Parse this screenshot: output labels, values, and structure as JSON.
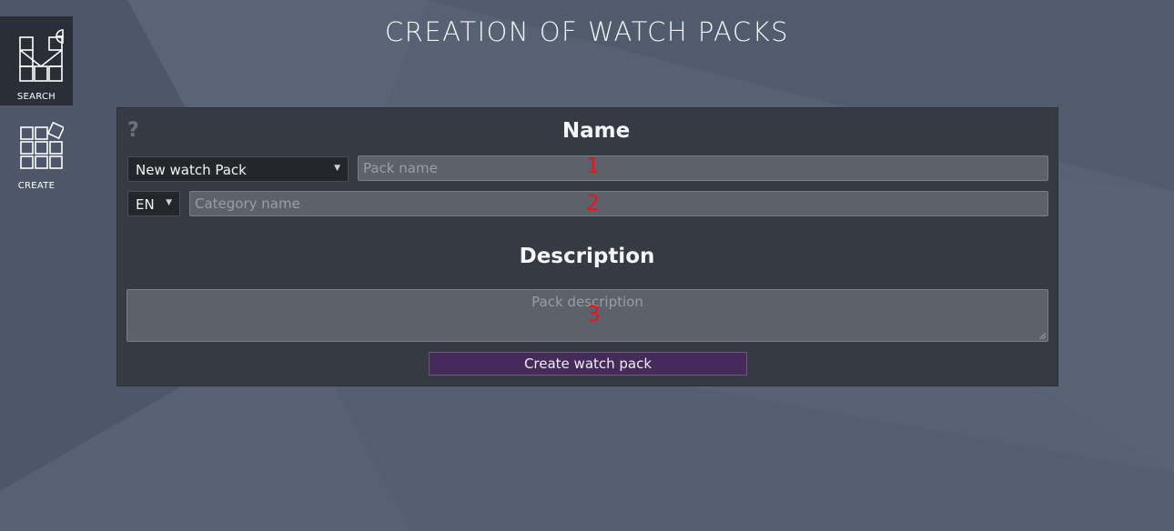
{
  "page": {
    "title": "CREATION OF WATCH PACKS"
  },
  "sidebar": {
    "items": [
      {
        "label": "SEARCH",
        "icon": "search-grid-plus-icon",
        "active": true
      },
      {
        "label": "CREATE",
        "icon": "create-grid-icon",
        "active": false
      }
    ]
  },
  "form": {
    "help_label": "?",
    "name_heading": "Name",
    "pack_select": {
      "selected": "New watch Pack"
    },
    "pack_name": {
      "placeholder": "Pack name",
      "marker": "1"
    },
    "language_select": {
      "selected": "EN"
    },
    "category_name": {
      "placeholder": "Category name",
      "marker": "2"
    },
    "description_heading": "Description",
    "pack_description": {
      "placeholder": "Pack description",
      "marker": "3"
    },
    "submit_label": "Create watch pack"
  },
  "colors": {
    "background": "#566273",
    "panel": "#363a43",
    "submit_button": "#452b59",
    "marker": "#e8141a"
  }
}
